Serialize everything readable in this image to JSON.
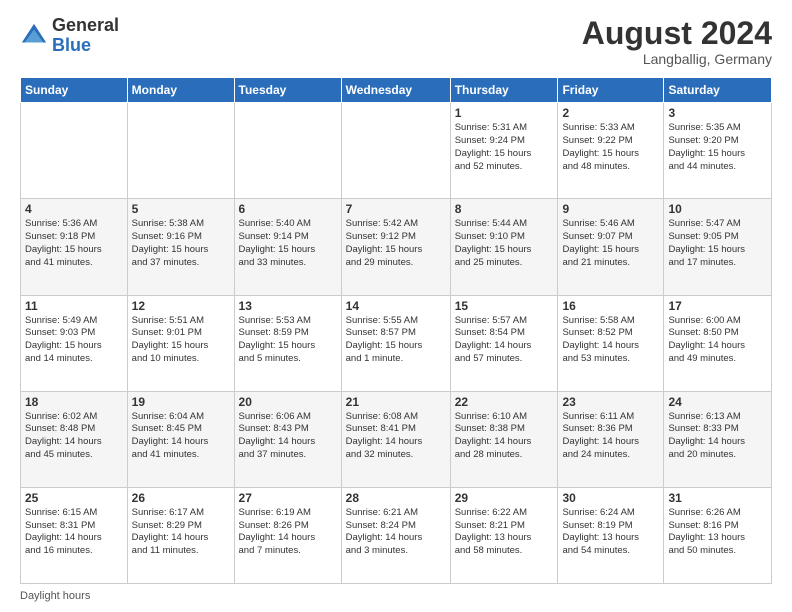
{
  "logo": {
    "general": "General",
    "blue": "Blue"
  },
  "header": {
    "month_year": "August 2024",
    "location": "Langballig, Germany"
  },
  "days_of_week": [
    "Sunday",
    "Monday",
    "Tuesday",
    "Wednesday",
    "Thursday",
    "Friday",
    "Saturday"
  ],
  "weeks": [
    [
      {
        "day": "",
        "info": ""
      },
      {
        "day": "",
        "info": ""
      },
      {
        "day": "",
        "info": ""
      },
      {
        "day": "",
        "info": ""
      },
      {
        "day": "1",
        "info": "Sunrise: 5:31 AM\nSunset: 9:24 PM\nDaylight: 15 hours\nand 52 minutes."
      },
      {
        "day": "2",
        "info": "Sunrise: 5:33 AM\nSunset: 9:22 PM\nDaylight: 15 hours\nand 48 minutes."
      },
      {
        "day": "3",
        "info": "Sunrise: 5:35 AM\nSunset: 9:20 PM\nDaylight: 15 hours\nand 44 minutes."
      }
    ],
    [
      {
        "day": "4",
        "info": "Sunrise: 5:36 AM\nSunset: 9:18 PM\nDaylight: 15 hours\nand 41 minutes."
      },
      {
        "day": "5",
        "info": "Sunrise: 5:38 AM\nSunset: 9:16 PM\nDaylight: 15 hours\nand 37 minutes."
      },
      {
        "day": "6",
        "info": "Sunrise: 5:40 AM\nSunset: 9:14 PM\nDaylight: 15 hours\nand 33 minutes."
      },
      {
        "day": "7",
        "info": "Sunrise: 5:42 AM\nSunset: 9:12 PM\nDaylight: 15 hours\nand 29 minutes."
      },
      {
        "day": "8",
        "info": "Sunrise: 5:44 AM\nSunset: 9:10 PM\nDaylight: 15 hours\nand 25 minutes."
      },
      {
        "day": "9",
        "info": "Sunrise: 5:46 AM\nSunset: 9:07 PM\nDaylight: 15 hours\nand 21 minutes."
      },
      {
        "day": "10",
        "info": "Sunrise: 5:47 AM\nSunset: 9:05 PM\nDaylight: 15 hours\nand 17 minutes."
      }
    ],
    [
      {
        "day": "11",
        "info": "Sunrise: 5:49 AM\nSunset: 9:03 PM\nDaylight: 15 hours\nand 14 minutes."
      },
      {
        "day": "12",
        "info": "Sunrise: 5:51 AM\nSunset: 9:01 PM\nDaylight: 15 hours\nand 10 minutes."
      },
      {
        "day": "13",
        "info": "Sunrise: 5:53 AM\nSunset: 8:59 PM\nDaylight: 15 hours\nand 5 minutes."
      },
      {
        "day": "14",
        "info": "Sunrise: 5:55 AM\nSunset: 8:57 PM\nDaylight: 15 hours\nand 1 minute."
      },
      {
        "day": "15",
        "info": "Sunrise: 5:57 AM\nSunset: 8:54 PM\nDaylight: 14 hours\nand 57 minutes."
      },
      {
        "day": "16",
        "info": "Sunrise: 5:58 AM\nSunset: 8:52 PM\nDaylight: 14 hours\nand 53 minutes."
      },
      {
        "day": "17",
        "info": "Sunrise: 6:00 AM\nSunset: 8:50 PM\nDaylight: 14 hours\nand 49 minutes."
      }
    ],
    [
      {
        "day": "18",
        "info": "Sunrise: 6:02 AM\nSunset: 8:48 PM\nDaylight: 14 hours\nand 45 minutes."
      },
      {
        "day": "19",
        "info": "Sunrise: 6:04 AM\nSunset: 8:45 PM\nDaylight: 14 hours\nand 41 minutes."
      },
      {
        "day": "20",
        "info": "Sunrise: 6:06 AM\nSunset: 8:43 PM\nDaylight: 14 hours\nand 37 minutes."
      },
      {
        "day": "21",
        "info": "Sunrise: 6:08 AM\nSunset: 8:41 PM\nDaylight: 14 hours\nand 32 minutes."
      },
      {
        "day": "22",
        "info": "Sunrise: 6:10 AM\nSunset: 8:38 PM\nDaylight: 14 hours\nand 28 minutes."
      },
      {
        "day": "23",
        "info": "Sunrise: 6:11 AM\nSunset: 8:36 PM\nDaylight: 14 hours\nand 24 minutes."
      },
      {
        "day": "24",
        "info": "Sunrise: 6:13 AM\nSunset: 8:33 PM\nDaylight: 14 hours\nand 20 minutes."
      }
    ],
    [
      {
        "day": "25",
        "info": "Sunrise: 6:15 AM\nSunset: 8:31 PM\nDaylight: 14 hours\nand 16 minutes."
      },
      {
        "day": "26",
        "info": "Sunrise: 6:17 AM\nSunset: 8:29 PM\nDaylight: 14 hours\nand 11 minutes."
      },
      {
        "day": "27",
        "info": "Sunrise: 6:19 AM\nSunset: 8:26 PM\nDaylight: 14 hours\nand 7 minutes."
      },
      {
        "day": "28",
        "info": "Sunrise: 6:21 AM\nSunset: 8:24 PM\nDaylight: 14 hours\nand 3 minutes."
      },
      {
        "day": "29",
        "info": "Sunrise: 6:22 AM\nSunset: 8:21 PM\nDaylight: 13 hours\nand 58 minutes."
      },
      {
        "day": "30",
        "info": "Sunrise: 6:24 AM\nSunset: 8:19 PM\nDaylight: 13 hours\nand 54 minutes."
      },
      {
        "day": "31",
        "info": "Sunrise: 6:26 AM\nSunset: 8:16 PM\nDaylight: 13 hours\nand 50 minutes."
      }
    ]
  ],
  "footer": {
    "daylight_label": "Daylight hours"
  }
}
